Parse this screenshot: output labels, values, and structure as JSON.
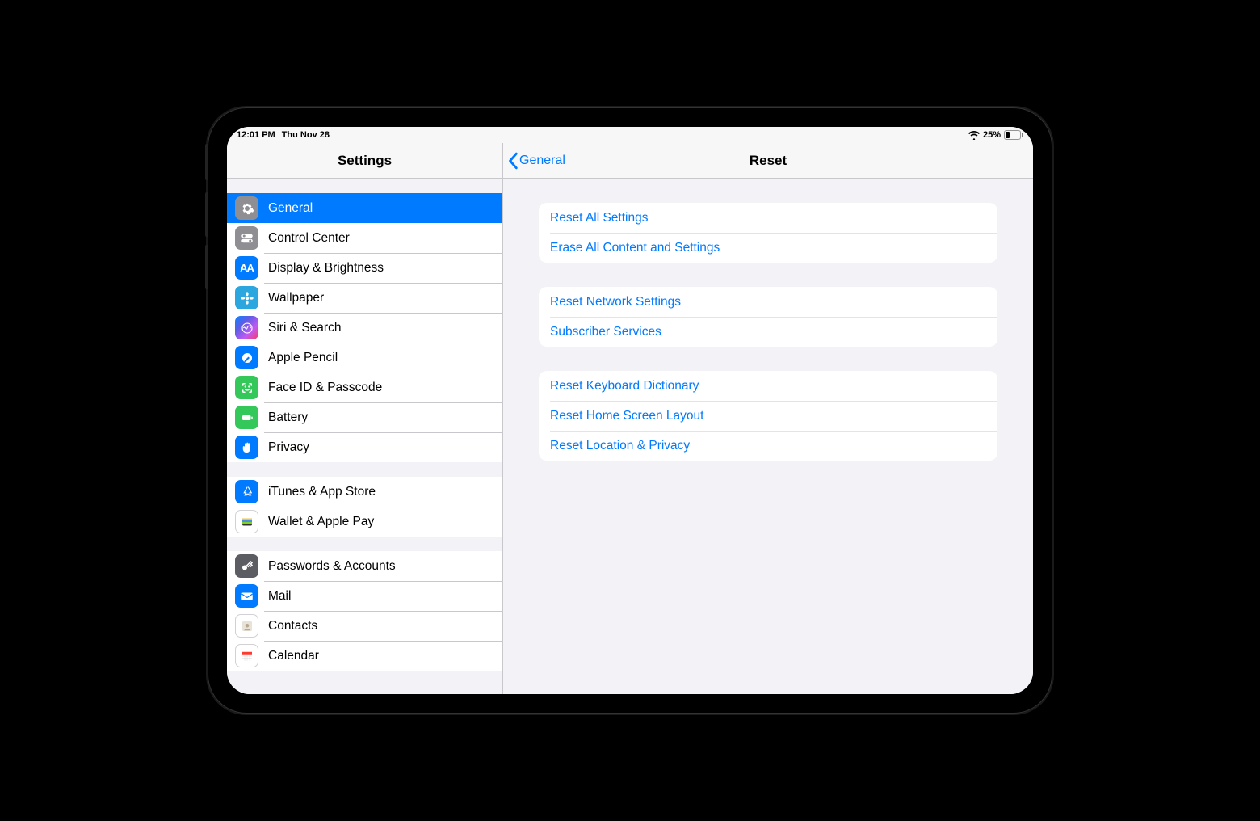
{
  "status": {
    "time": "12:01 PM",
    "date": "Thu Nov 28",
    "battery_pct": "25%"
  },
  "sidebar": {
    "title": "Settings",
    "groups": [
      {
        "items": [
          {
            "id": "general",
            "label": "General",
            "icon": "gear",
            "bg": "bg-gray",
            "selected": true
          },
          {
            "id": "control-center",
            "label": "Control Center",
            "icon": "switches",
            "bg": "bg-gray"
          },
          {
            "id": "display",
            "label": "Display & Brightness",
            "icon": "aa",
            "bg": "bg-blue"
          },
          {
            "id": "wallpaper",
            "label": "Wallpaper",
            "icon": "flower",
            "bg": "bg-flower"
          },
          {
            "id": "siri",
            "label": "Siri & Search",
            "icon": "siri",
            "bg": "bg-multisiri"
          },
          {
            "id": "pencil",
            "label": "Apple Pencil",
            "icon": "pencil",
            "bg": "bg-blue"
          },
          {
            "id": "faceid",
            "label": "Face ID & Passcode",
            "icon": "face",
            "bg": "bg-green"
          },
          {
            "id": "battery",
            "label": "Battery",
            "icon": "battery",
            "bg": "bg-green"
          },
          {
            "id": "privacy",
            "label": "Privacy",
            "icon": "hand",
            "bg": "bg-blue"
          }
        ]
      },
      {
        "items": [
          {
            "id": "itunes",
            "label": "iTunes & App Store",
            "icon": "appstore",
            "bg": "bg-blue"
          },
          {
            "id": "wallet",
            "label": "Wallet & Apple Pay",
            "icon": "wallet",
            "bg": "bg-white"
          }
        ]
      },
      {
        "items": [
          {
            "id": "passwords",
            "label": "Passwords & Accounts",
            "icon": "key",
            "bg": "bg-darkgray"
          },
          {
            "id": "mail",
            "label": "Mail",
            "icon": "mail",
            "bg": "bg-blue"
          },
          {
            "id": "contacts",
            "label": "Contacts",
            "icon": "contacts",
            "bg": "bg-white"
          },
          {
            "id": "calendar",
            "label": "Calendar",
            "icon": "calendar",
            "bg": "bg-cal"
          }
        ]
      }
    ]
  },
  "detail": {
    "back_label": "General",
    "title": "Reset",
    "groups": [
      {
        "items": [
          {
            "id": "reset-all",
            "label": "Reset All Settings"
          },
          {
            "id": "erase-all",
            "label": "Erase All Content and Settings"
          }
        ]
      },
      {
        "items": [
          {
            "id": "reset-network",
            "label": "Reset Network Settings"
          },
          {
            "id": "subscriber",
            "label": "Subscriber Services"
          }
        ]
      },
      {
        "items": [
          {
            "id": "reset-keyboard",
            "label": "Reset Keyboard Dictionary"
          },
          {
            "id": "reset-home",
            "label": "Reset Home Screen Layout"
          },
          {
            "id": "reset-location",
            "label": "Reset Location & Privacy"
          }
        ]
      }
    ]
  }
}
